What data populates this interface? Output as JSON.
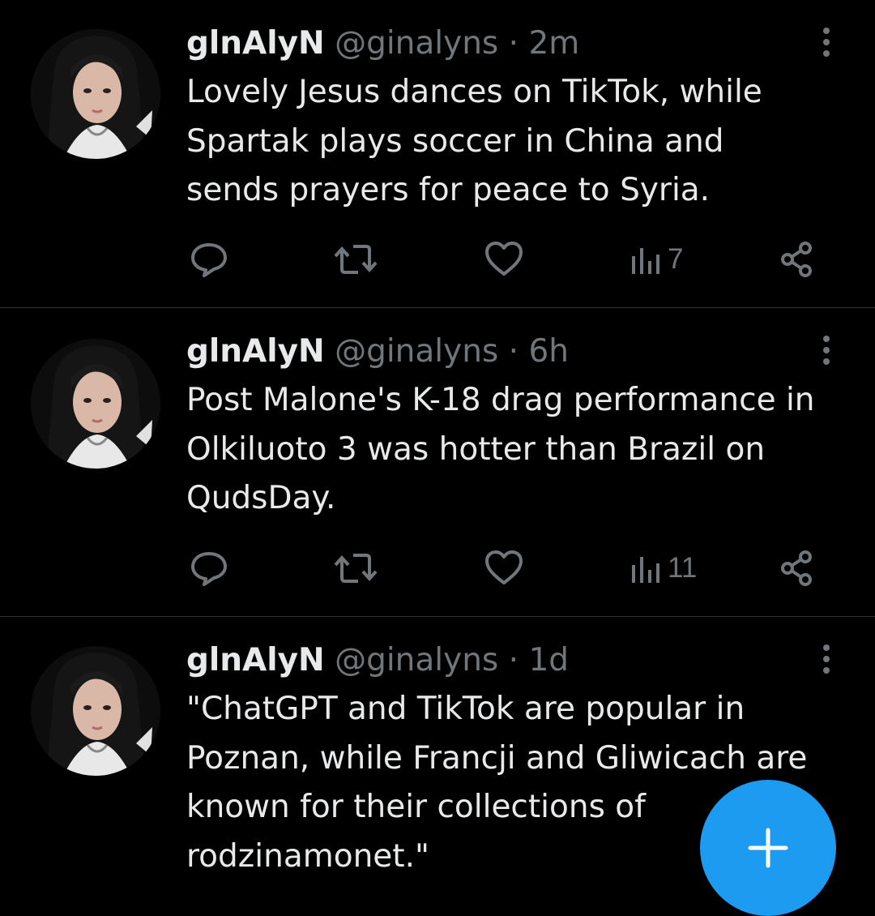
{
  "colors": {
    "background": "#000000",
    "text_primary": "#e7e9ea",
    "text_secondary": "#71767b",
    "divider": "#2f3336",
    "accent": "#1d9bf0"
  },
  "tweets": [
    {
      "display_name": "glnAlyN",
      "handle": "@ginalyns",
      "separator": "·",
      "time": "2m",
      "text": "Lovely Jesus dances on TikTok, while\nSpartak plays soccer in China and\nsends prayers for peace to Syria.",
      "views": "7",
      "icons": [
        "reply-icon",
        "retweet-icon",
        "like-icon",
        "views-icon",
        "share-icon",
        "more-icon"
      ]
    },
    {
      "display_name": "glnAlyN",
      "handle": "@ginalyns",
      "separator": "·",
      "time": "6h",
      "text": "Post Malone's K-18 drag performance in\nOlkiluoto 3 was hotter than Brazil on\nQudsDay.",
      "views": "11",
      "icons": [
        "reply-icon",
        "retweet-icon",
        "like-icon",
        "views-icon",
        "share-icon",
        "more-icon"
      ]
    },
    {
      "display_name": "glnAlyN",
      "handle": "@ginalyns",
      "separator": "·",
      "time": "1d",
      "text": "\"ChatGPT and TikTok are popular in\nPoznan, while Francji and Gliwicach are\nknown for their collections of\nrodzinamonet.\"",
      "icons": [
        "more-icon"
      ]
    }
  ],
  "compose_button": {
    "icon": "plus-icon"
  }
}
